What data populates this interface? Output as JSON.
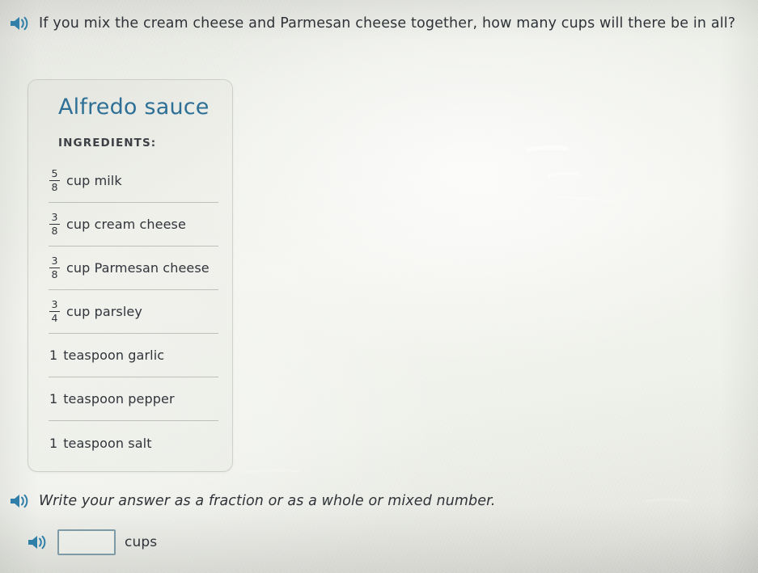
{
  "question": {
    "speaker_icon": "speaker-icon",
    "text": "If you mix the cream cheese and Parmesan cheese together, how many cups will there be in all?"
  },
  "recipe_card": {
    "title": "Alfredo sauce",
    "ingredients_label": "INGREDIENTS:",
    "ingredients": [
      {
        "numerator": "5",
        "denominator": "8",
        "whole": "",
        "name": "cup milk"
      },
      {
        "numerator": "3",
        "denominator": "8",
        "whole": "",
        "name": "cup cream cheese"
      },
      {
        "numerator": "3",
        "denominator": "8",
        "whole": "",
        "name": "cup Parmesan cheese"
      },
      {
        "numerator": "3",
        "denominator": "4",
        "whole": "",
        "name": "cup parsley"
      },
      {
        "numerator": "",
        "denominator": "",
        "whole": "1",
        "name": "teaspoon garlic"
      },
      {
        "numerator": "",
        "denominator": "",
        "whole": "1",
        "name": "teaspoon pepper"
      },
      {
        "numerator": "",
        "denominator": "",
        "whole": "1",
        "name": "teaspoon salt"
      }
    ]
  },
  "answer": {
    "speaker_icon": "speaker-icon",
    "instruction": "Write your answer as a fraction or as a whole or mixed number.",
    "input_value": "",
    "input_placeholder": "",
    "unit": "cups"
  },
  "colors": {
    "title_blue": "#2e6f96",
    "speaker_blue": "#2f7fa8",
    "text_dark": "#2f3338",
    "input_border": "#7d9aa6",
    "divider": "#96988e",
    "page_background": "#eef0ea"
  }
}
